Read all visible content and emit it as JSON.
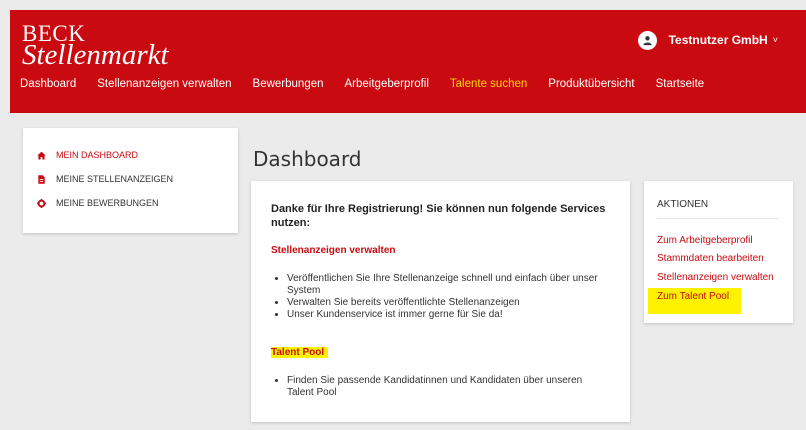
{
  "brand": {
    "line1": "BECK",
    "line2": "Stellenmarkt"
  },
  "user": {
    "name": "Testnutzer GmbH",
    "chevron": "˅",
    "icon": "user-icon"
  },
  "nav": {
    "items": [
      {
        "label": "Dashboard",
        "active": false
      },
      {
        "label": "Stellenanzeigen verwalten",
        "active": false
      },
      {
        "label": "Bewerbungen",
        "active": false
      },
      {
        "label": "Arbeitgeberprofil",
        "active": false
      },
      {
        "label": "Talente suchen",
        "active": true
      },
      {
        "label": "Produktübersicht",
        "active": false
      },
      {
        "label": "Startseite",
        "active": false
      }
    ]
  },
  "sidebar": {
    "items": [
      {
        "label": "MEIN DASHBOARD",
        "icon": "home-icon",
        "active": true
      },
      {
        "label": "MEINE STELLENANZEIGEN",
        "icon": "document-icon",
        "active": false
      },
      {
        "label": "MEINE BEWERBUNGEN",
        "icon": "gear-icon",
        "active": false
      }
    ]
  },
  "main": {
    "title": "Dashboard",
    "intro": "Danke für Ihre Registrierung! Sie können nun folgende Services nutzen:",
    "section1": {
      "heading": "Stellenanzeigen verwalten",
      "bullets": [
        "Veröffentlichen Sie Ihre Stellenanzeige schnell und einfach über unser System",
        "Verwalten Sie bereits veröffentlichte Stellenanzeigen",
        "Unser Kundenservice ist immer gerne für Sie da!"
      ]
    },
    "section2": {
      "heading": "Talent Pool",
      "bullets": [
        "Finden Sie passende Kandidatinnen und Kandidaten über unseren Talent Pool"
      ]
    }
  },
  "aktionen": {
    "heading": "AKTIONEN",
    "links": [
      "Zum Arbeitgeberprofil",
      "Stammdaten bearbeiten",
      "Stellenanzeigen verwalten",
      "Zum Talent Pool"
    ]
  },
  "colors": {
    "brand_red": "#c90b11",
    "active_nav": "#ffd700",
    "highlight": "#fff200"
  }
}
